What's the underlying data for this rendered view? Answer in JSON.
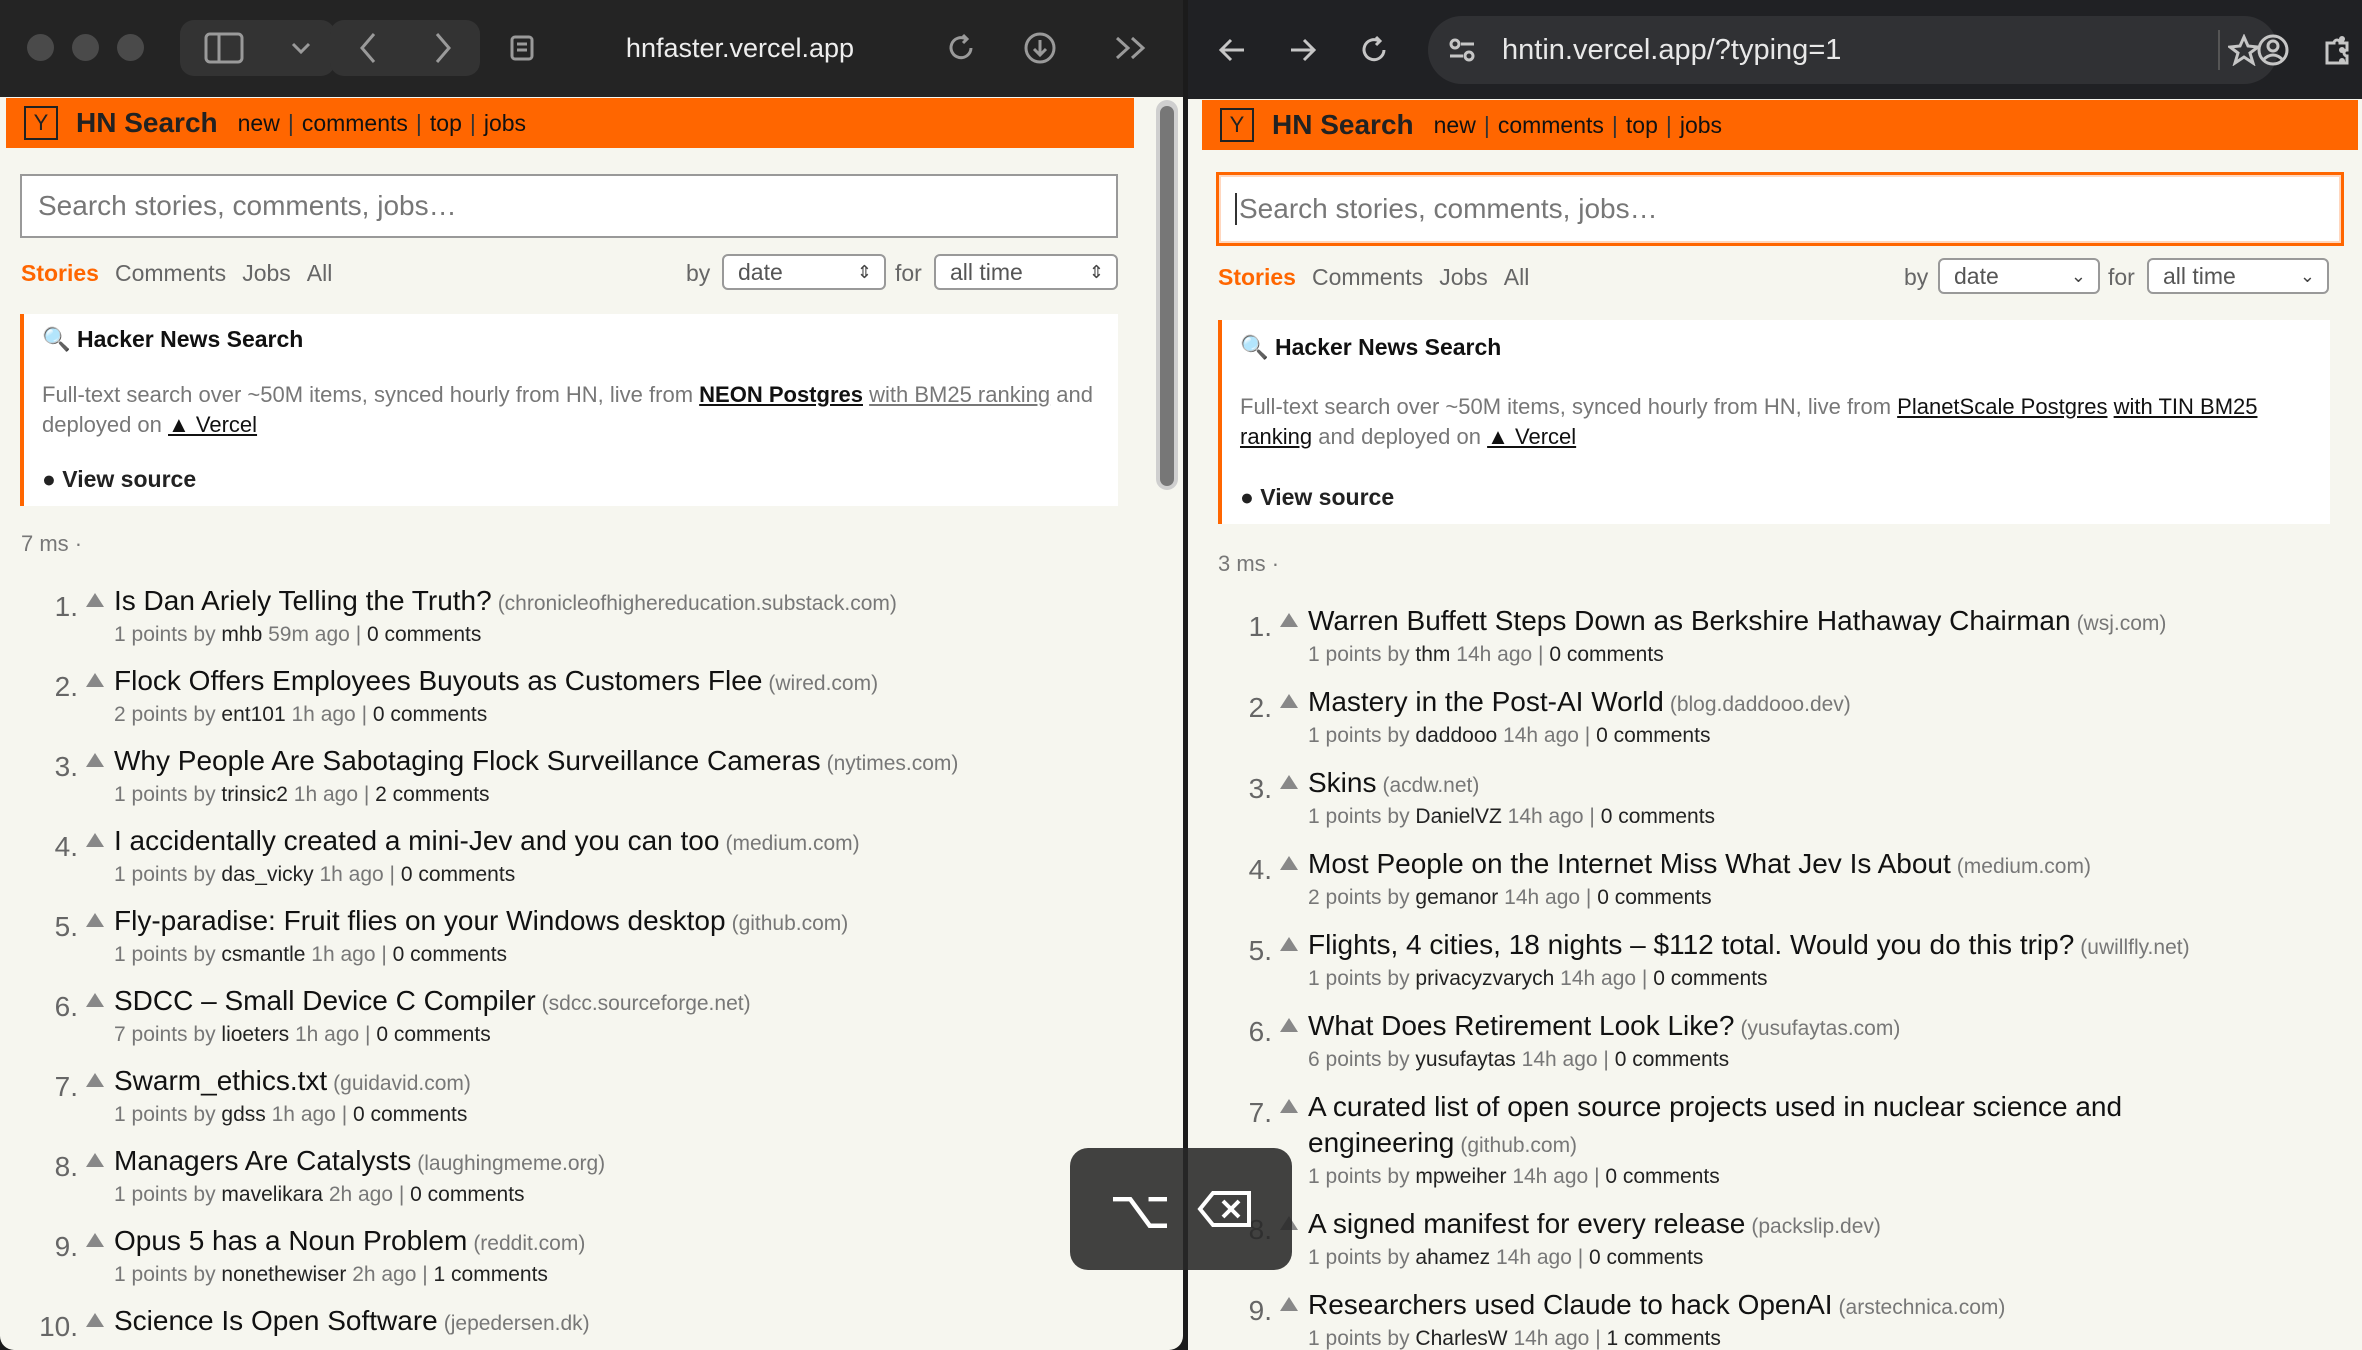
{
  "left": {
    "url": "hnfaster.vercel.app",
    "brand": "HN Search",
    "nav": [
      "new",
      "comments",
      "top",
      "jobs"
    ],
    "search_placeholder": "Search stories, comments, jobs…",
    "tabs": [
      "Stories",
      "Comments",
      "Jobs",
      "All"
    ],
    "by_label": "by",
    "by_value": "date",
    "for_label": "for",
    "for_value": "all time",
    "info": {
      "title": "Hacker News Search",
      "body_prefix": "Full-text search over ~50M items, synced hourly from HN, live from",
      "db_link": "NEON Postgres",
      "rank_link": "with BM25 ranking",
      "deployed": "and deployed on",
      "host_link": "▲ Vercel",
      "source": "View source"
    },
    "timing": "7 ms ·",
    "stories": [
      {
        "num": "1.",
        "title": "Is Dan Ariely Telling the Truth?",
        "domain": "(chronicleofhighereducation.substack.com)",
        "points": "1 points by",
        "user": "mhb",
        "age": "59m ago",
        "comments": "0 comments"
      },
      {
        "num": "2.",
        "title": "Flock Offers Employees Buyouts as Customers Flee",
        "domain": "(wired.com)",
        "points": "2 points by",
        "user": "ent101",
        "age": "1h ago",
        "comments": "0 comments"
      },
      {
        "num": "3.",
        "title": "Why People Are Sabotaging Flock Surveillance Cameras",
        "domain": "(nytimes.com)",
        "points": "1 points by",
        "user": "trinsic2",
        "age": "1h ago",
        "comments": "2 comments"
      },
      {
        "num": "4.",
        "title": "I accidentally created a mini-Jev and you can too",
        "domain": "(medium.com)",
        "points": "1 points by",
        "user": "das_vicky",
        "age": "1h ago",
        "comments": "0 comments"
      },
      {
        "num": "5.",
        "title": "Fly-paradise: Fruit flies on your Windows desktop",
        "domain": "(github.com)",
        "points": "1 points by",
        "user": "csmantle",
        "age": "1h ago",
        "comments": "0 comments"
      },
      {
        "num": "6.",
        "title": "SDCC – Small Device C Compiler",
        "domain": "(sdcc.sourceforge.net)",
        "points": "7 points by",
        "user": "lioeters",
        "age": "1h ago",
        "comments": "0 comments"
      },
      {
        "num": "7.",
        "title": "Swarm_ethics.txt",
        "domain": "(guidavid.com)",
        "points": "1 points by",
        "user": "gdss",
        "age": "1h ago",
        "comments": "0 comments"
      },
      {
        "num": "8.",
        "title": "Managers Are Catalysts",
        "domain": "(laughingmeme.org)",
        "points": "1 points by",
        "user": "mavelikara",
        "age": "2h ago",
        "comments": "0 comments"
      },
      {
        "num": "9.",
        "title": "Opus 5 has a Noun Problem",
        "domain": "(reddit.com)",
        "points": "1 points by",
        "user": "nonethewiser",
        "age": "2h ago",
        "comments": "1 comments"
      },
      {
        "num": "10.",
        "title": "Science Is Open Software",
        "domain": "(jepedersen.dk)",
        "points": "",
        "user": "",
        "age": "",
        "comments": ""
      }
    ]
  },
  "right": {
    "url": "hntin.vercel.app/?typing=1",
    "brand": "HN Search",
    "nav": [
      "new",
      "comments",
      "top",
      "jobs"
    ],
    "search_placeholder": "Search stories, comments, jobs…",
    "tabs": [
      "Stories",
      "Comments",
      "Jobs",
      "All"
    ],
    "by_label": "by",
    "by_value": "date",
    "for_label": "for",
    "for_value": "all time",
    "info": {
      "title": "Hacker News Search",
      "body_prefix": "Full-text search over ~50M items, synced hourly from HN, live from",
      "db_link": "PlanetScale Postgres",
      "rank_link": "with TIN BM25 ranking",
      "deployed": "and deployed on",
      "host_link": "▲ Vercel",
      "source": "View source"
    },
    "timing": "3 ms ·",
    "stories": [
      {
        "num": "1.",
        "title": "Warren Buffett Steps Down as Berkshire Hathaway Chairman",
        "domain": "(wsj.com)",
        "points": "1 points by",
        "user": "thm",
        "age": "14h ago",
        "comments": "0 comments"
      },
      {
        "num": "2.",
        "title": "Mastery in the Post-AI World",
        "domain": "(blog.daddooo.dev)",
        "points": "1 points by",
        "user": "daddooo",
        "age": "14h ago",
        "comments": "0 comments"
      },
      {
        "num": "3.",
        "title": "Skins",
        "domain": "(acdw.net)",
        "points": "1 points by",
        "user": "DanielVZ",
        "age": "14h ago",
        "comments": "0 comments"
      },
      {
        "num": "4.",
        "title": "Most People on the Internet Miss What Jev Is About",
        "domain": "(medium.com)",
        "points": "2 points by",
        "user": "gemanor",
        "age": "14h ago",
        "comments": "0 comments"
      },
      {
        "num": "5.",
        "title": "Flights, 4 cities, 18 nights – $112 total. Would you do this trip?",
        "domain": "(uwillfly.net)",
        "points": "1 points by",
        "user": "privacyzvarych",
        "age": "14h ago",
        "comments": "0 comments"
      },
      {
        "num": "6.",
        "title": "What Does Retirement Look Like?",
        "domain": "(yusufaytas.com)",
        "points": "6 points by",
        "user": "yusufaytas",
        "age": "14h ago",
        "comments": "0 comments"
      },
      {
        "num": "7.",
        "title": "A curated list of open source projects used in nuclear science and",
        "title2": "engineering",
        "domain": "(github.com)",
        "points": "1 points by",
        "user": "mpweiher",
        "age": "14h ago",
        "comments": "0 comments"
      },
      {
        "num": "8.",
        "title": "A signed manifest for every release",
        "domain": "(packslip.dev)",
        "points": "1 points by",
        "user": "ahamez",
        "age": "14h ago",
        "comments": "0 comments"
      },
      {
        "num": "9.",
        "title": "Researchers used Claude to hack OpenAI",
        "domain": "(arstechnica.com)",
        "points": "1 points by",
        "user": "CharlesW",
        "age": "14h ago",
        "comments": "1 comments"
      }
    ]
  },
  "overlay": {
    "keys": "⌥"
  },
  "colors": {
    "accent": "#ff6600",
    "page_bg": "#f6f6ef",
    "safari_bar": "#242424",
    "chrome_bar": "#202124"
  }
}
